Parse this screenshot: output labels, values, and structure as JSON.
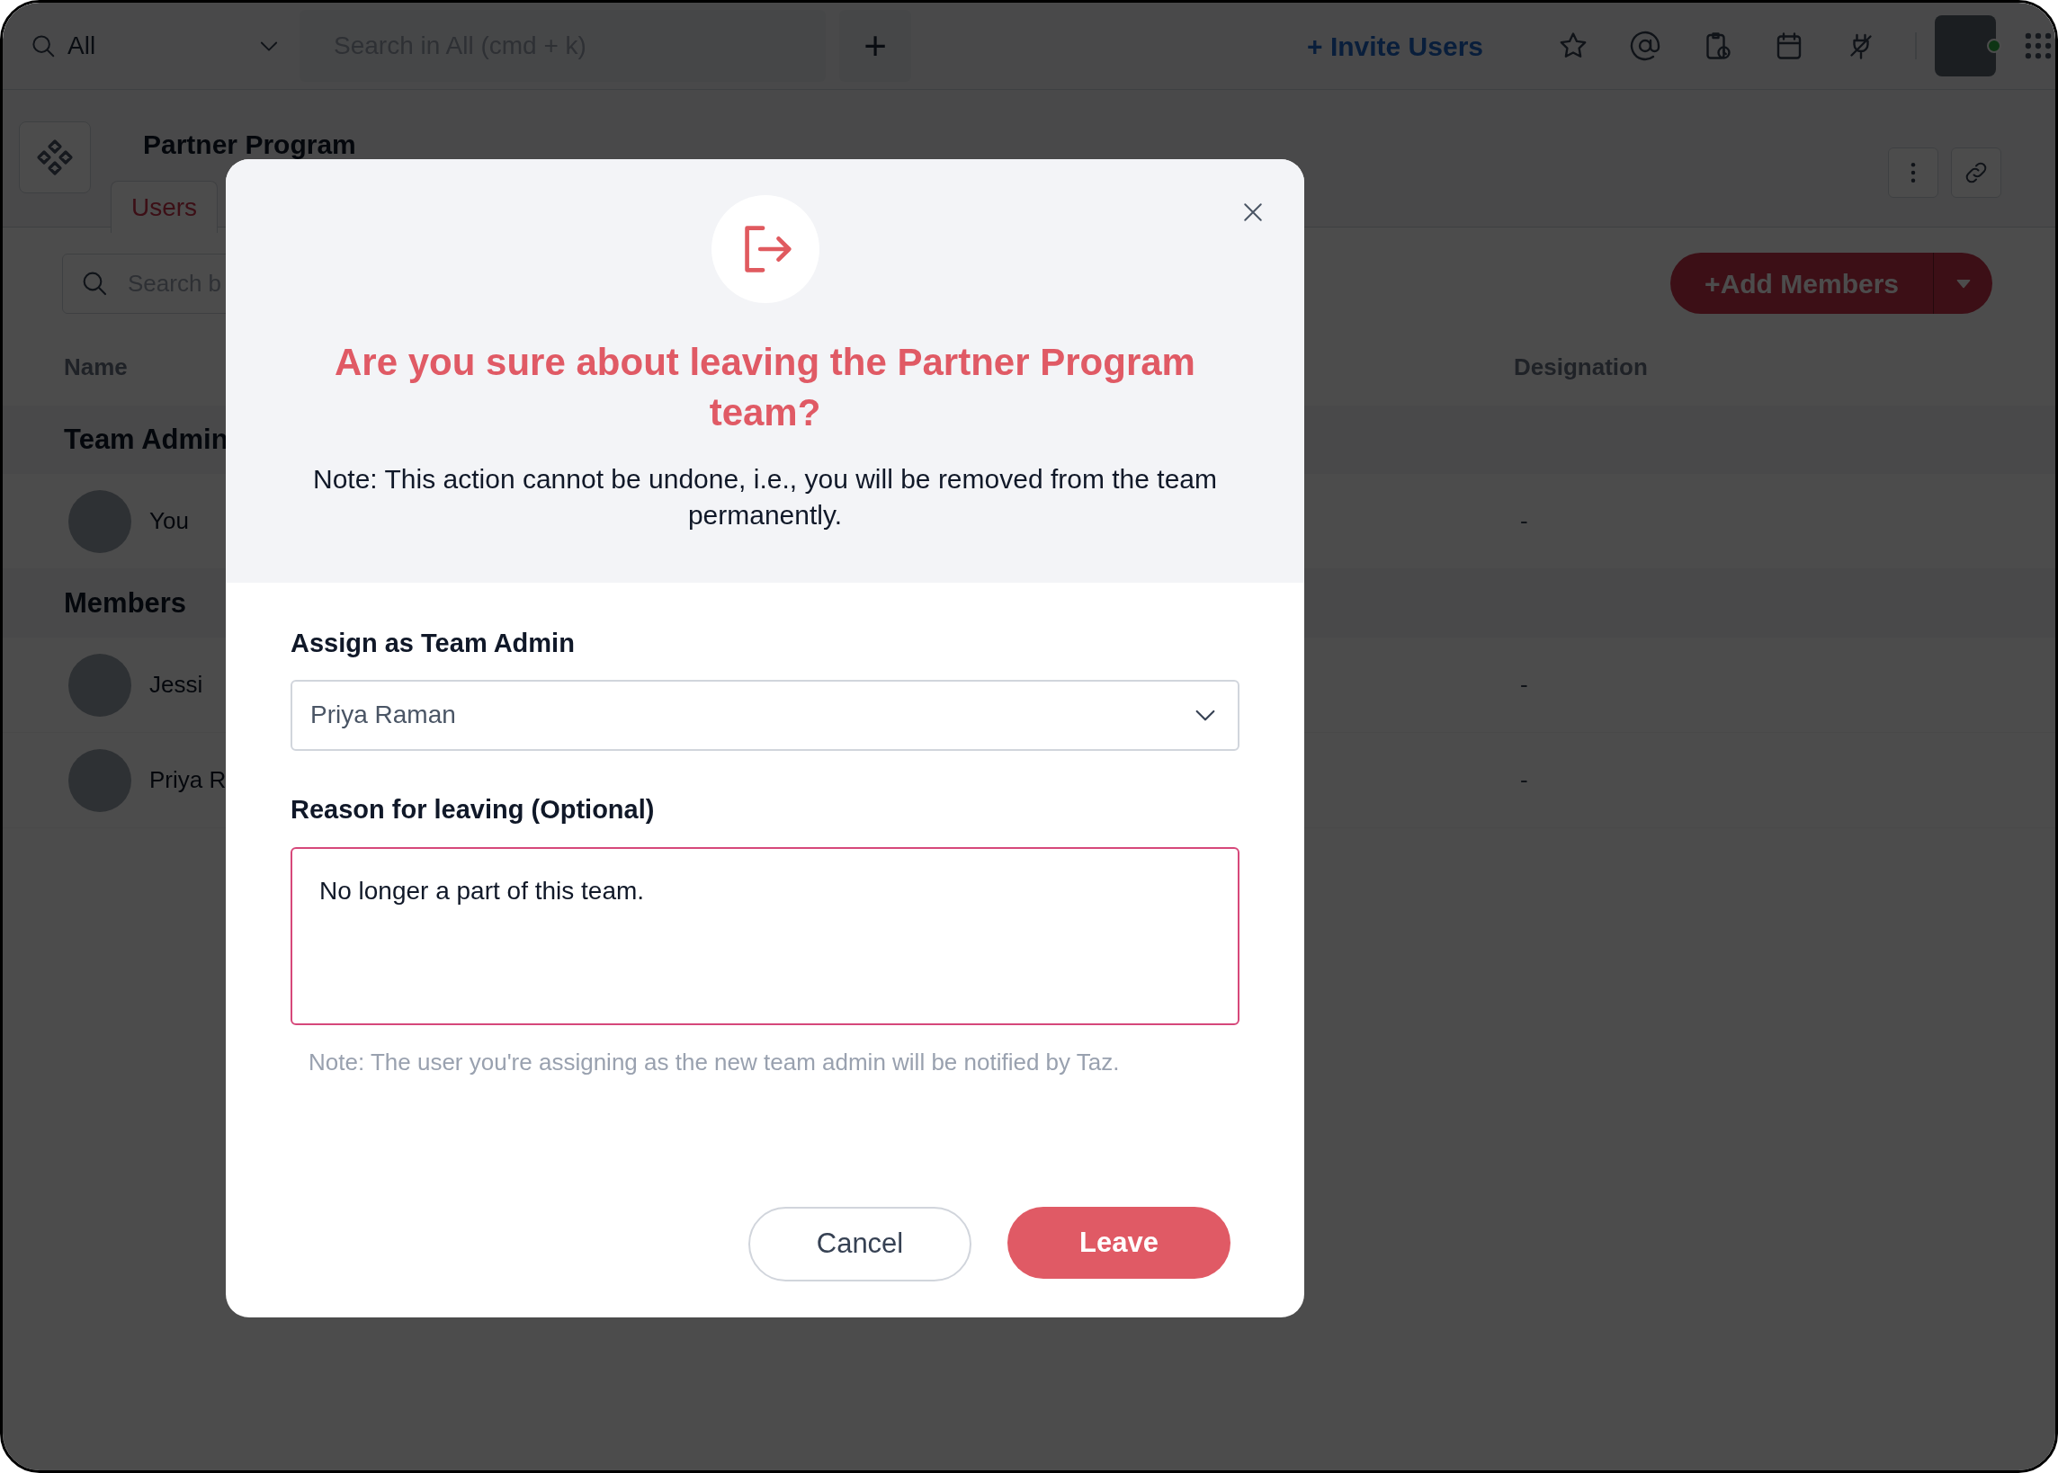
{
  "top_bar": {
    "scope": "All",
    "search": {
      "placeholder": "Search in All (cmd + k)"
    },
    "new_button": "+",
    "invite_link": "+ Invite Users",
    "user_online": true
  },
  "team": {
    "name": "Partner Program",
    "tabs": [
      {
        "label": "Users",
        "selected": true
      }
    ]
  },
  "members_search": {
    "placeholder": "Search b"
  },
  "add_button": "+Add Members",
  "table": {
    "columns": [
      "Name",
      "Designation"
    ],
    "groups": [
      {
        "title": "Team Admin",
        "rows": [
          {
            "name": "You",
            "designation": "-"
          }
        ]
      },
      {
        "title": "Members",
        "rows": [
          {
            "name": "Jessi",
            "designation": "-"
          },
          {
            "name": "Priya R",
            "designation": "-"
          }
        ]
      }
    ]
  },
  "dialog": {
    "title": "Are you sure about leaving the Partner Program team?",
    "note": "Note: This action cannot be undone, i.e., you will be removed from the team permanently.",
    "assign_label": "Assign as Team Admin",
    "assign_value": "Priya Raman",
    "reason_label": "Reason for leaving (Optional)",
    "reason_value": "No longer a part of this team.",
    "hint": "Note: The user you're assigning as the new team admin will be notified by Taz.",
    "buttons": [
      {
        "label": "Cancel",
        "kind": "secondary"
      },
      {
        "label": "Leave",
        "kind": "primary"
      }
    ]
  }
}
